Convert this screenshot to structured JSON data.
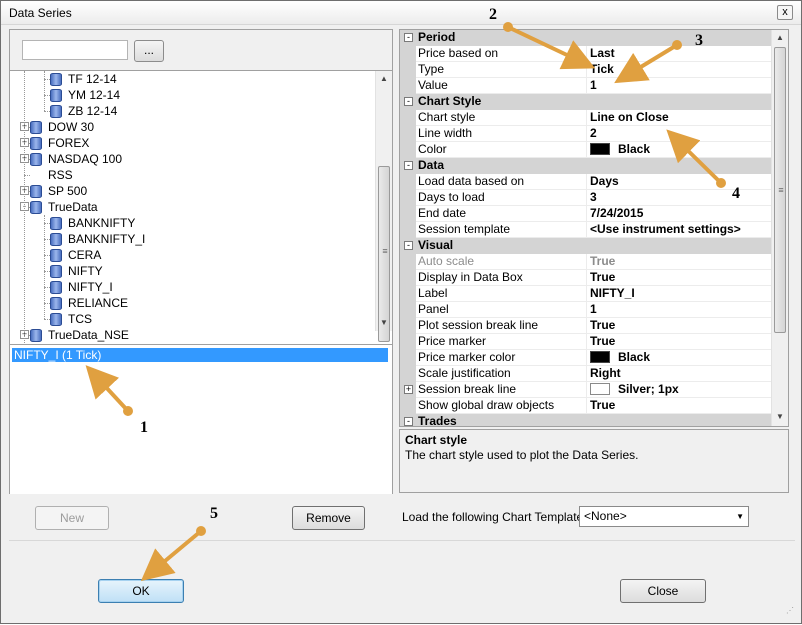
{
  "window": {
    "title": "Data Series",
    "close_glyph": "x"
  },
  "left": {
    "search_placeholder": "",
    "browse_label": "...",
    "tree": [
      {
        "label": "TF 12-14",
        "level": 2,
        "icon": "database-icon"
      },
      {
        "label": "YM 12-14",
        "level": 2,
        "icon": "database-icon"
      },
      {
        "label": "ZB 12-14",
        "level": 2,
        "icon": "database-icon"
      },
      {
        "label": "DOW 30",
        "level": 1,
        "icon": "database-icon",
        "expander": "+"
      },
      {
        "label": "FOREX",
        "level": 1,
        "icon": "database-icon",
        "expander": "+"
      },
      {
        "label": "NASDAQ 100",
        "level": 1,
        "icon": "database-icon",
        "expander": "+"
      },
      {
        "label": "RSS",
        "level": 1,
        "icon": "none"
      },
      {
        "label": "SP 500",
        "level": 1,
        "icon": "database-icon",
        "expander": "+"
      },
      {
        "label": "TrueData",
        "level": 1,
        "icon": "database-icon",
        "expander": "-"
      },
      {
        "label": "BANKNIFTY",
        "level": 2,
        "icon": "database-icon"
      },
      {
        "label": "BANKNIFTY_I",
        "level": 2,
        "icon": "database-icon"
      },
      {
        "label": "CERA",
        "level": 2,
        "icon": "database-icon"
      },
      {
        "label": "NIFTY",
        "level": 2,
        "icon": "database-icon"
      },
      {
        "label": "NIFTY_I",
        "level": 2,
        "icon": "database-icon"
      },
      {
        "label": "RELIANCE",
        "level": 2,
        "icon": "database-icon"
      },
      {
        "label": "TCS",
        "level": 2,
        "icon": "database-icon"
      },
      {
        "label": "TrueData_NSE",
        "level": 1,
        "icon": "database-icon",
        "expander": "+"
      }
    ],
    "series_items": [
      "NIFTY_I (1 Tick)"
    ],
    "new_label": "New",
    "remove_label": "Remove"
  },
  "grid": {
    "rows": [
      {
        "type": "cat",
        "name": "Period",
        "expander": "-"
      },
      {
        "name": "Price based on",
        "value": "Last"
      },
      {
        "name": "Type",
        "value": "Tick"
      },
      {
        "name": "Value",
        "value": "1"
      },
      {
        "type": "cat",
        "name": "Chart Style",
        "expander": "-"
      },
      {
        "name": "Chart style",
        "value": "Line on Close"
      },
      {
        "name": "Line width",
        "value": "2"
      },
      {
        "name": "Color",
        "value": "Black",
        "swatch": "#000000"
      },
      {
        "type": "cat",
        "name": "Data",
        "expander": "-"
      },
      {
        "name": "Load data based on",
        "value": "Days"
      },
      {
        "name": "Days to load",
        "value": "3"
      },
      {
        "name": "End date",
        "value": "7/24/2015"
      },
      {
        "name": "Session template",
        "value": "<Use instrument settings>"
      },
      {
        "type": "cat",
        "name": "Visual",
        "expander": "-"
      },
      {
        "name": "Auto scale",
        "value": "True",
        "disabled": true
      },
      {
        "name": "Display in Data Box",
        "value": "True"
      },
      {
        "name": "Label",
        "value": "NIFTY_I"
      },
      {
        "name": "Panel",
        "value": "1"
      },
      {
        "name": "Plot session break line",
        "value": "True"
      },
      {
        "name": "Price marker",
        "value": "True"
      },
      {
        "name": "Price marker color",
        "value": "Black",
        "swatch": "#000000"
      },
      {
        "name": "Scale justification",
        "value": "Right"
      },
      {
        "name": "Session break line",
        "value": "Silver; 1px",
        "swatch": "#ffffff",
        "expander": "+"
      },
      {
        "name": "Show global draw objects",
        "value": "True"
      },
      {
        "type": "cat",
        "name": "Trades",
        "expander": "-"
      }
    ]
  },
  "description": {
    "title": "Chart style",
    "text": "The chart style used to plot the Data Series."
  },
  "template": {
    "label": "Load the following Chart Template:",
    "selected": "<None>"
  },
  "footer": {
    "ok_label": "OK",
    "close_label": "Close"
  },
  "annotations": [
    "1",
    "2",
    "3",
    "4",
    "5"
  ],
  "colors": {
    "annotation": "#e0a040",
    "selection": "#3399ff"
  }
}
